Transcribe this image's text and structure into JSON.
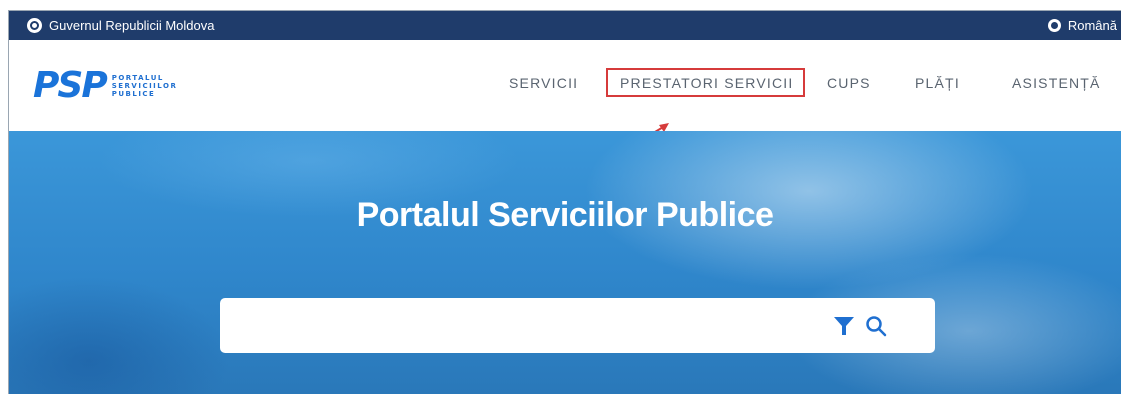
{
  "gov_bar": {
    "title": "Guvernul Republicii Moldova",
    "language": "Română"
  },
  "logo": {
    "letters": "PSP",
    "line1": "PORTALUL",
    "line2": "SERVICIILOR",
    "line3": "PUBLICE"
  },
  "nav": {
    "items": [
      {
        "label": "SERVICII"
      },
      {
        "label": "PRESTATORI SERVICII"
      },
      {
        "label": "CUPS"
      },
      {
        "label": "PLĂȚI"
      },
      {
        "label": "ASISTENȚĂ"
      }
    ]
  },
  "hero": {
    "title": "Portalul Serviciilor Publice"
  },
  "search": {
    "value": "",
    "placeholder": ""
  },
  "icons": {
    "emblem": "moldova-emblem-icon",
    "globe": "globe-icon",
    "filter": "filter-icon",
    "search": "search-icon",
    "arrow": "annotation-arrow-icon"
  },
  "colors": {
    "gov_bar": "#1f3c6b",
    "brand_blue": "#1a73d9",
    "highlight_red": "#d63b3b",
    "hero_blue": "#3b97d9"
  }
}
